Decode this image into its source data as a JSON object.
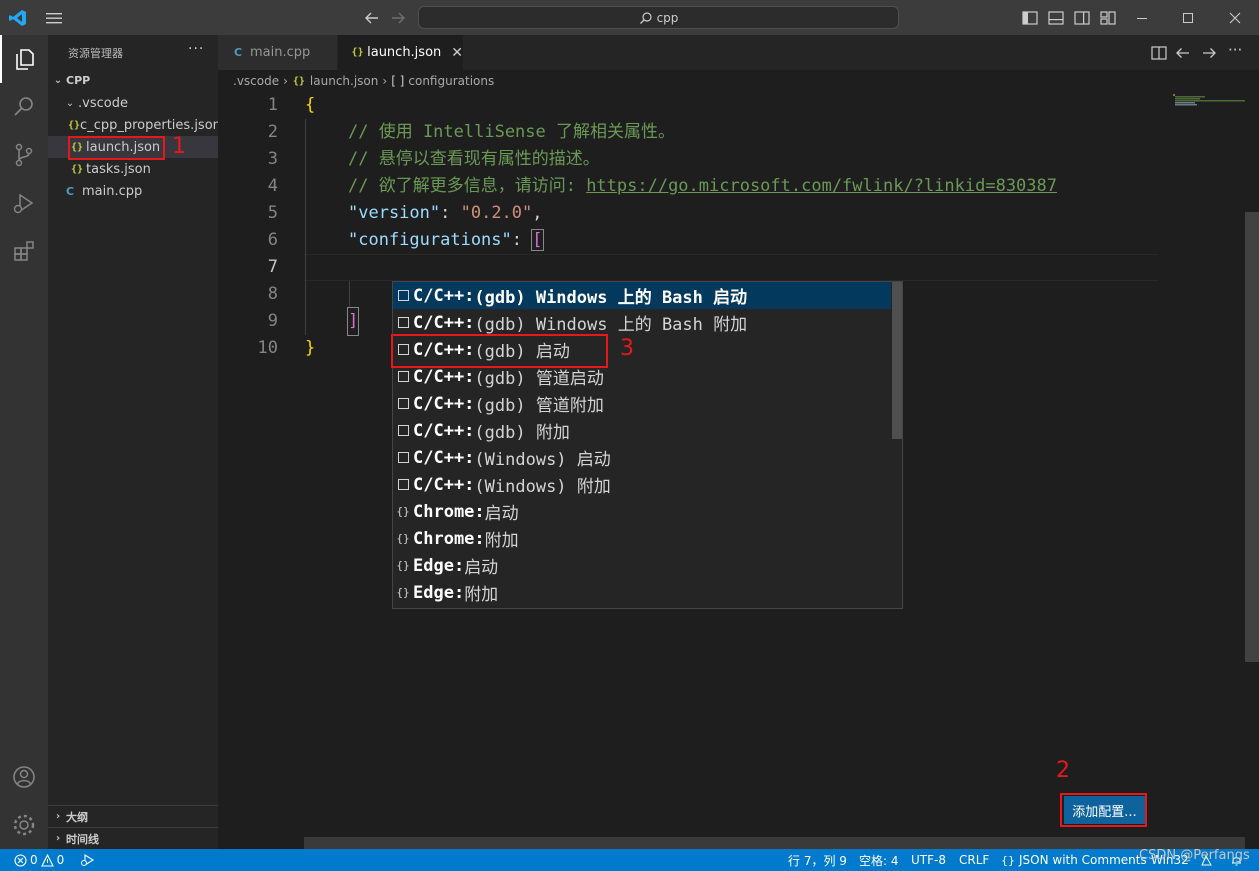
{
  "titlebar": {
    "search_text": "cpp"
  },
  "sidebar": {
    "title": "资源管理器",
    "more": "···",
    "root": "CPP",
    "folder": ".vscode",
    "files": [
      {
        "name": "c_cpp_properties.json",
        "type": "json"
      },
      {
        "name": "launch.json",
        "type": "json"
      },
      {
        "name": "tasks.json",
        "type": "json"
      }
    ],
    "root_file": "main.cpp",
    "outline": "大纲",
    "timeline": "时间线"
  },
  "tabs": [
    {
      "label": "main.cpp",
      "active": false
    },
    {
      "label": "launch.json",
      "active": true
    }
  ],
  "breadcrumb": {
    "folder": ".vscode",
    "file": "launch.json",
    "symbol": "configurations"
  },
  "editor": {
    "line_numbers": [
      "1",
      "2",
      "3",
      "4",
      "5",
      "6",
      "7",
      "8",
      "9",
      "10"
    ],
    "comment_1": "// 使用 IntelliSense 了解相关属性。",
    "comment_2": "// 悬停以查看现有属性的描述。",
    "comment_3_prefix": "// 欲了解更多信息，请访问: ",
    "comment_3_link": "https://go.microsoft.com/fwlink/?linkid=830387",
    "version_key": "\"version\"",
    "version_value": "\"0.2.0\"",
    "configurations_key": "\"configurations\""
  },
  "suggestions": [
    {
      "icon": "snippet",
      "highlight": "C/C++:",
      "rest": " (gdb) Windows 上的 Bash 启动"
    },
    {
      "icon": "snippet",
      "highlight": "C/C++:",
      "rest": " (gdb) Windows 上的 Bash 附加"
    },
    {
      "icon": "snippet",
      "highlight": "C/C++:",
      "rest": " (gdb) 启动"
    },
    {
      "icon": "snippet",
      "highlight": "C/C++:",
      "rest": " (gdb) 管道启动"
    },
    {
      "icon": "snippet",
      "highlight": "C/C++:",
      "rest": " (gdb) 管道附加"
    },
    {
      "icon": "snippet",
      "highlight": "C/C++:",
      "rest": " (gdb) 附加"
    },
    {
      "icon": "snippet",
      "highlight": "C/C++:",
      "rest": " (Windows) 启动"
    },
    {
      "icon": "snippet",
      "highlight": "C/C++:",
      "rest": " (Windows) 附加"
    },
    {
      "icon": "braces",
      "highlight": "Chrome:",
      "rest": " 启动"
    },
    {
      "icon": "braces",
      "highlight": "Chrome:",
      "rest": " 附加"
    },
    {
      "icon": "braces",
      "highlight": "Edge:",
      "rest": " 启动"
    },
    {
      "icon": "braces",
      "highlight": "Edge:",
      "rest": " 附加"
    }
  ],
  "add_config_button": "添加配置...",
  "annotations": [
    "1",
    "2",
    "3"
  ],
  "statusbar": {
    "errors": "0",
    "warnings": "0",
    "position": "行 7，列 9",
    "spaces": "空格: 4",
    "encoding": "UTF-8",
    "eol": "CRLF",
    "language": "JSON with Comments",
    "platform": "Win32"
  },
  "watermark": "CSDN @Perfangs",
  "colors": {
    "accent": "#007acc",
    "annotation": "#e5191b",
    "button": "#0e639c"
  }
}
